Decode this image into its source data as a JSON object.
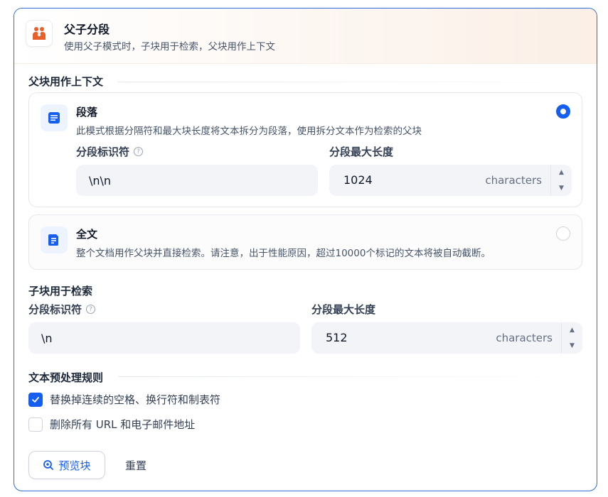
{
  "header": {
    "title": "父子分段",
    "description": "使用父子模式时，子块用于检索，父块用作上下文",
    "icon": "parent-child-icon",
    "accent": "#e8612c"
  },
  "parent": {
    "section_title": "父块用作上下文",
    "options": [
      {
        "title": "段落",
        "description": "此模式根据分隔符和最大块长度将文本拆分为段落，使用拆分文本作为检索的父块",
        "icon": "paragraph-icon",
        "selected": true
      },
      {
        "title": "全文",
        "description": "整个文档用作父块并直接检索。请注意，出于性能原因，超过10000个标记的文本将被自动截断。",
        "icon": "full-doc-icon",
        "selected": false
      }
    ],
    "delimiter_label": "分段标识符",
    "delimiter_value": "\\n\\n",
    "max_length_label": "分段最大长度",
    "max_length_value": "1024",
    "unit": "characters"
  },
  "child": {
    "section_title": "子块用于检索",
    "delimiter_label": "分段标识符",
    "delimiter_value": "\\n",
    "max_length_label": "分段最大长度",
    "max_length_value": "512",
    "unit": "characters"
  },
  "preprocess": {
    "section_title": "文本预处理规则",
    "rules": [
      {
        "label": "替换掉连续的空格、换行符和制表符",
        "checked": true
      },
      {
        "label": "删除所有 URL 和电子邮件地址",
        "checked": false
      }
    ]
  },
  "actions": {
    "preview_label": "预览块",
    "reset_label": "重置"
  },
  "colors": {
    "primary": "#155eef",
    "border_active": "#2f6bdc"
  }
}
